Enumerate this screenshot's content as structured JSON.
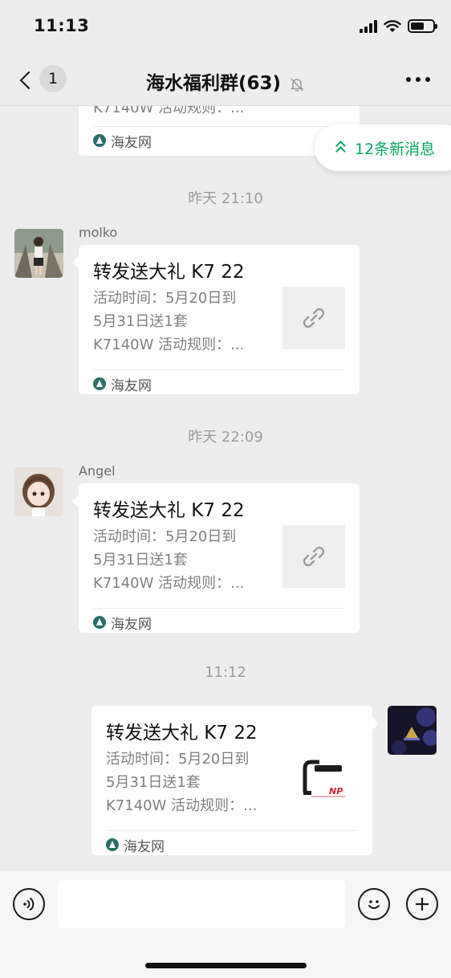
{
  "status_bar": {
    "time": "11:13"
  },
  "nav": {
    "back_count": "1",
    "title": "海水福利群(63)"
  },
  "new_messages_pill": "12条新消息",
  "partial_card": {
    "desc_tail": "K7140W 活动规则：...",
    "source": "海友网"
  },
  "messages": [
    {
      "timestamp": "昨天 21:10",
      "sender": "molko",
      "title": "转发送大礼 K7 22",
      "desc": [
        "活动时间：5月20日到",
        "5月31日送1套",
        "K7140W 活动规则：..."
      ],
      "source": "海友网"
    },
    {
      "timestamp": "昨天 22:09",
      "sender": "Angel",
      "title": "转发送大礼 K7 22",
      "desc": [
        "活动时间：5月20日到",
        "5月31日送1套",
        "K7140W 活动规则：..."
      ],
      "source": "海友网"
    },
    {
      "timestamp": "11:12",
      "sender": "",
      "title": "转发送大礼 K7 22",
      "desc": [
        "活动时间：5月20日到",
        "5月31日送1套",
        "K7140W 活动规则：..."
      ],
      "source": "海友网",
      "thumb_text": "NP"
    }
  ],
  "colors": {
    "accent": "#07a75e",
    "background": "#ededed"
  },
  "icons": [
    "back-chevron-icon",
    "mute-bell-icon",
    "more-icon",
    "link-icon",
    "voice-icon",
    "emoji-icon",
    "plus-icon"
  ]
}
